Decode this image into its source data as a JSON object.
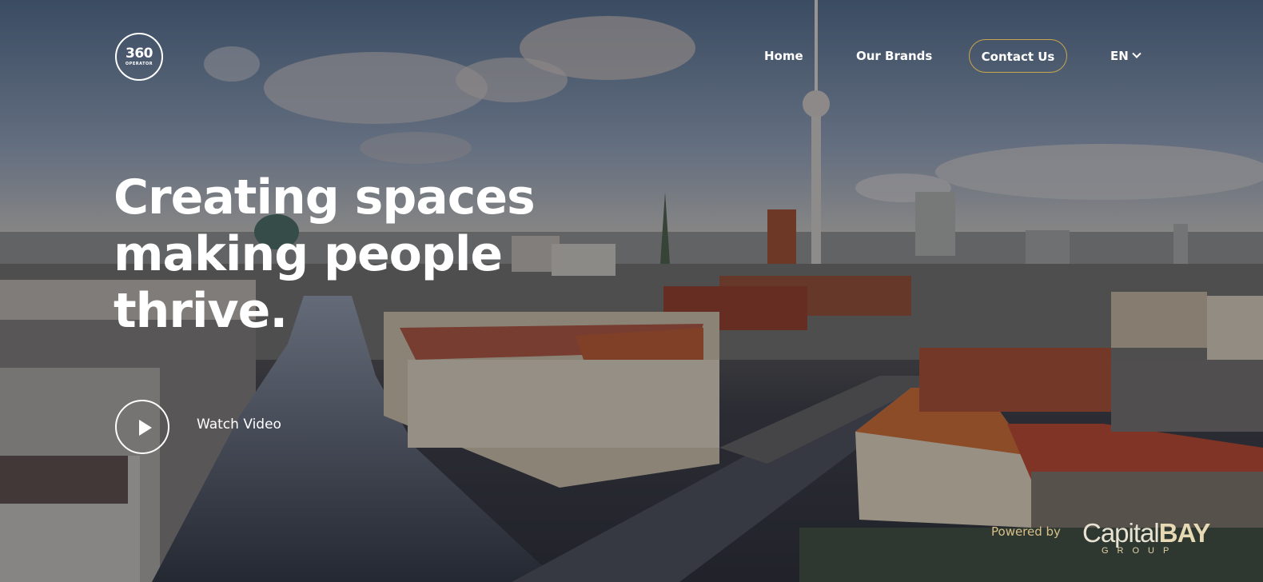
{
  "logo": {
    "number": "360",
    "subtitle": "OPERATOR"
  },
  "nav": {
    "items": [
      {
        "label": "Home"
      },
      {
        "label": "Our Brands"
      },
      {
        "label": "Contact Us"
      }
    ],
    "language": "EN"
  },
  "hero": {
    "headline": [
      "Creating spaces",
      "making people",
      "thrive."
    ],
    "video_label": "Watch Video"
  },
  "footer": {
    "powered_label": "Powered by",
    "brand_light": "Capital",
    "brand_bold": "BAY",
    "brand_sub": "GROUP"
  },
  "colors": {
    "accent_gold": "#c8a74c",
    "text": "#ffffff"
  },
  "icons": [
    "play-icon",
    "chevron-down-icon"
  ]
}
